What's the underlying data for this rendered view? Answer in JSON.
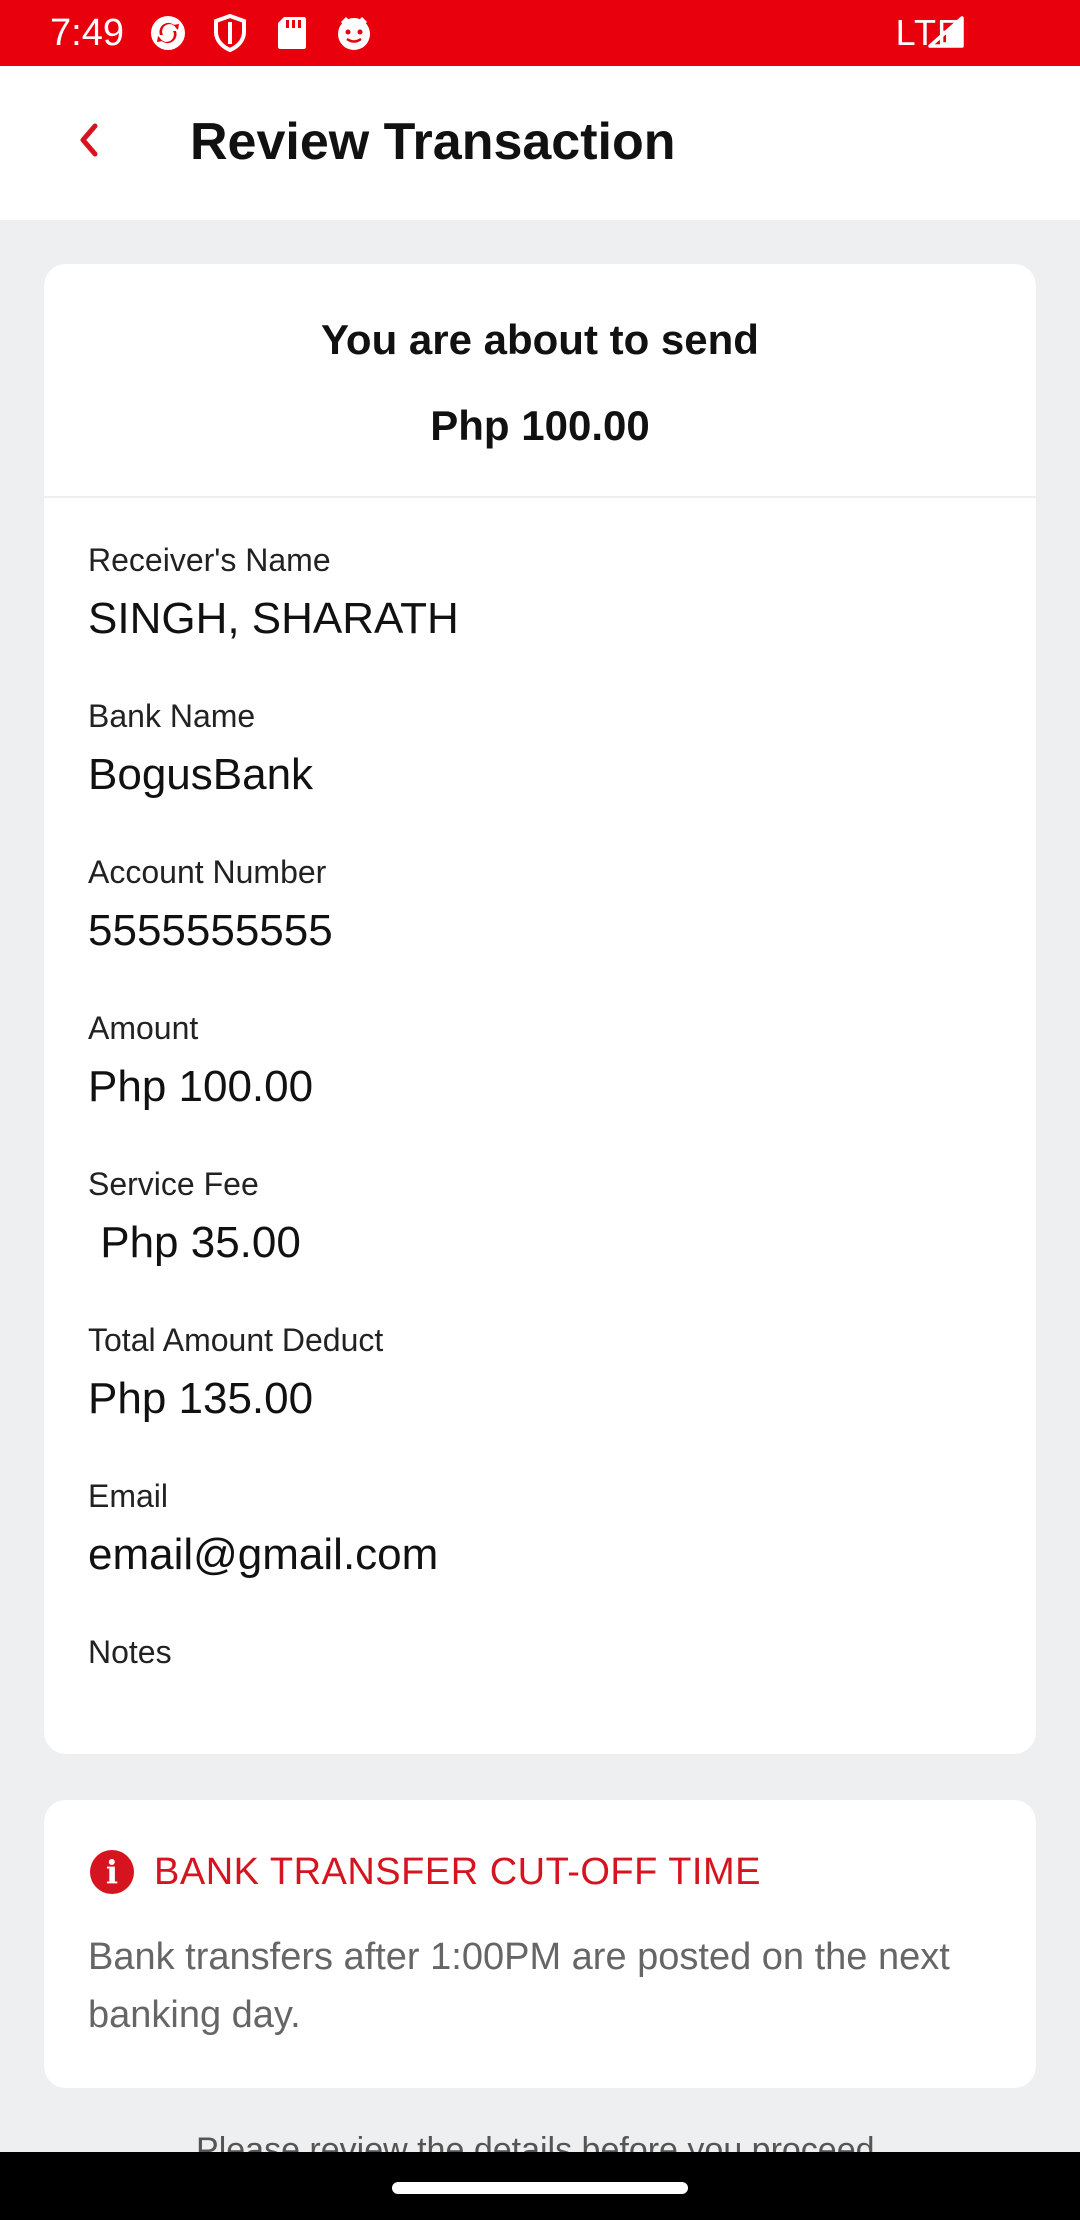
{
  "status_bar": {
    "time": "7:49",
    "network": "LTE",
    "left_icons": [
      "sync-icon",
      "shield-icon",
      "sd-card-icon",
      "face-icon"
    ]
  },
  "app_bar": {
    "title": "Review Transaction",
    "back_icon": "chevron-left-icon"
  },
  "summary": {
    "heading": "You are about to send",
    "amount": "Php 100.00"
  },
  "details": [
    {
      "label": "Receiver's Name",
      "value": "SINGH, SHARATH"
    },
    {
      "label": "Bank Name",
      "value": "BogusBank"
    },
    {
      "label": "Account Number",
      "value": "5555555555"
    },
    {
      "label": "Amount",
      "value": "Php 100.00"
    },
    {
      "label": "Service Fee",
      "value": " Php 35.00"
    },
    {
      "label": "Total Amount Deduct",
      "value": "Php 135.00"
    },
    {
      "label": "Email",
      "value": "email@gmail.com"
    },
    {
      "label": "Notes",
      "value": ""
    }
  ],
  "notice": {
    "icon": "info-icon",
    "title": "BANK TRANSFER CUT-OFF TIME",
    "body": "Bank transfers after 1:00PM are posted on the next banking day."
  },
  "footer_hint": "Please review the details before you proceed.",
  "colors": {
    "accent": "#d6141f",
    "status_bar": "#e8000d",
    "background": "#eeeff1"
  }
}
